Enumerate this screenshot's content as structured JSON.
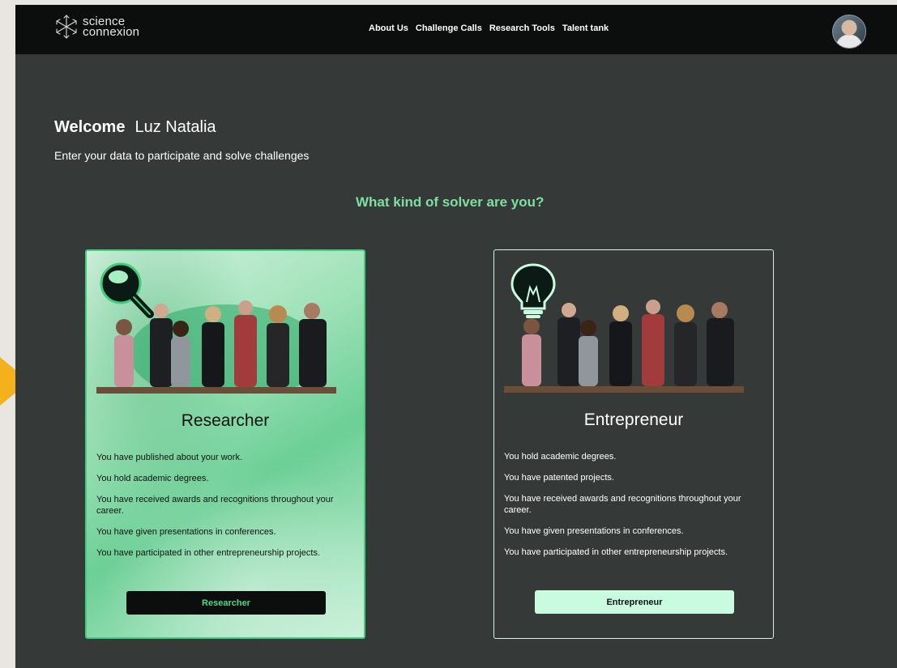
{
  "colors": {
    "accent_green": "#7ee0a0",
    "pointer_arrow": "#f3b21b",
    "bg_dark": "#353a39",
    "topbar": "#0c0e0e"
  },
  "header": {
    "logo": {
      "line1": "science",
      "line2": "connexion",
      "icon": "snowflake-logo-icon"
    },
    "nav": [
      "About Us",
      "Challenge Calls",
      "Research Tools",
      "Talent tank"
    ],
    "avatar_icon": "user-avatar"
  },
  "welcome": {
    "label": "Welcome",
    "name": "Luz Natalia"
  },
  "subtitle": "Enter your data to participate and solve challenges",
  "question": "What kind of solver are you?",
  "cards": [
    {
      "title": "Researcher",
      "icon": "magnifying-glass-icon",
      "features": [
        "You have published about your work.",
        "You hold academic degrees.",
        "You have received awards and recognitions throughout your career.",
        "You have given presentations in conferences.",
        "You have participated in other entrepreneurship projects."
      ],
      "button": "Researcher"
    },
    {
      "title": "Entrepreneur",
      "icon": "lightbulb-icon",
      "features": [
        "You hold academic degrees.",
        "You have patented projects.",
        "You have received awards and recognitions throughout your career.",
        "You have given presentations in conferences.",
        "You have participated in other entrepreneurship projects."
      ],
      "button": "Entrepreneur"
    }
  ]
}
